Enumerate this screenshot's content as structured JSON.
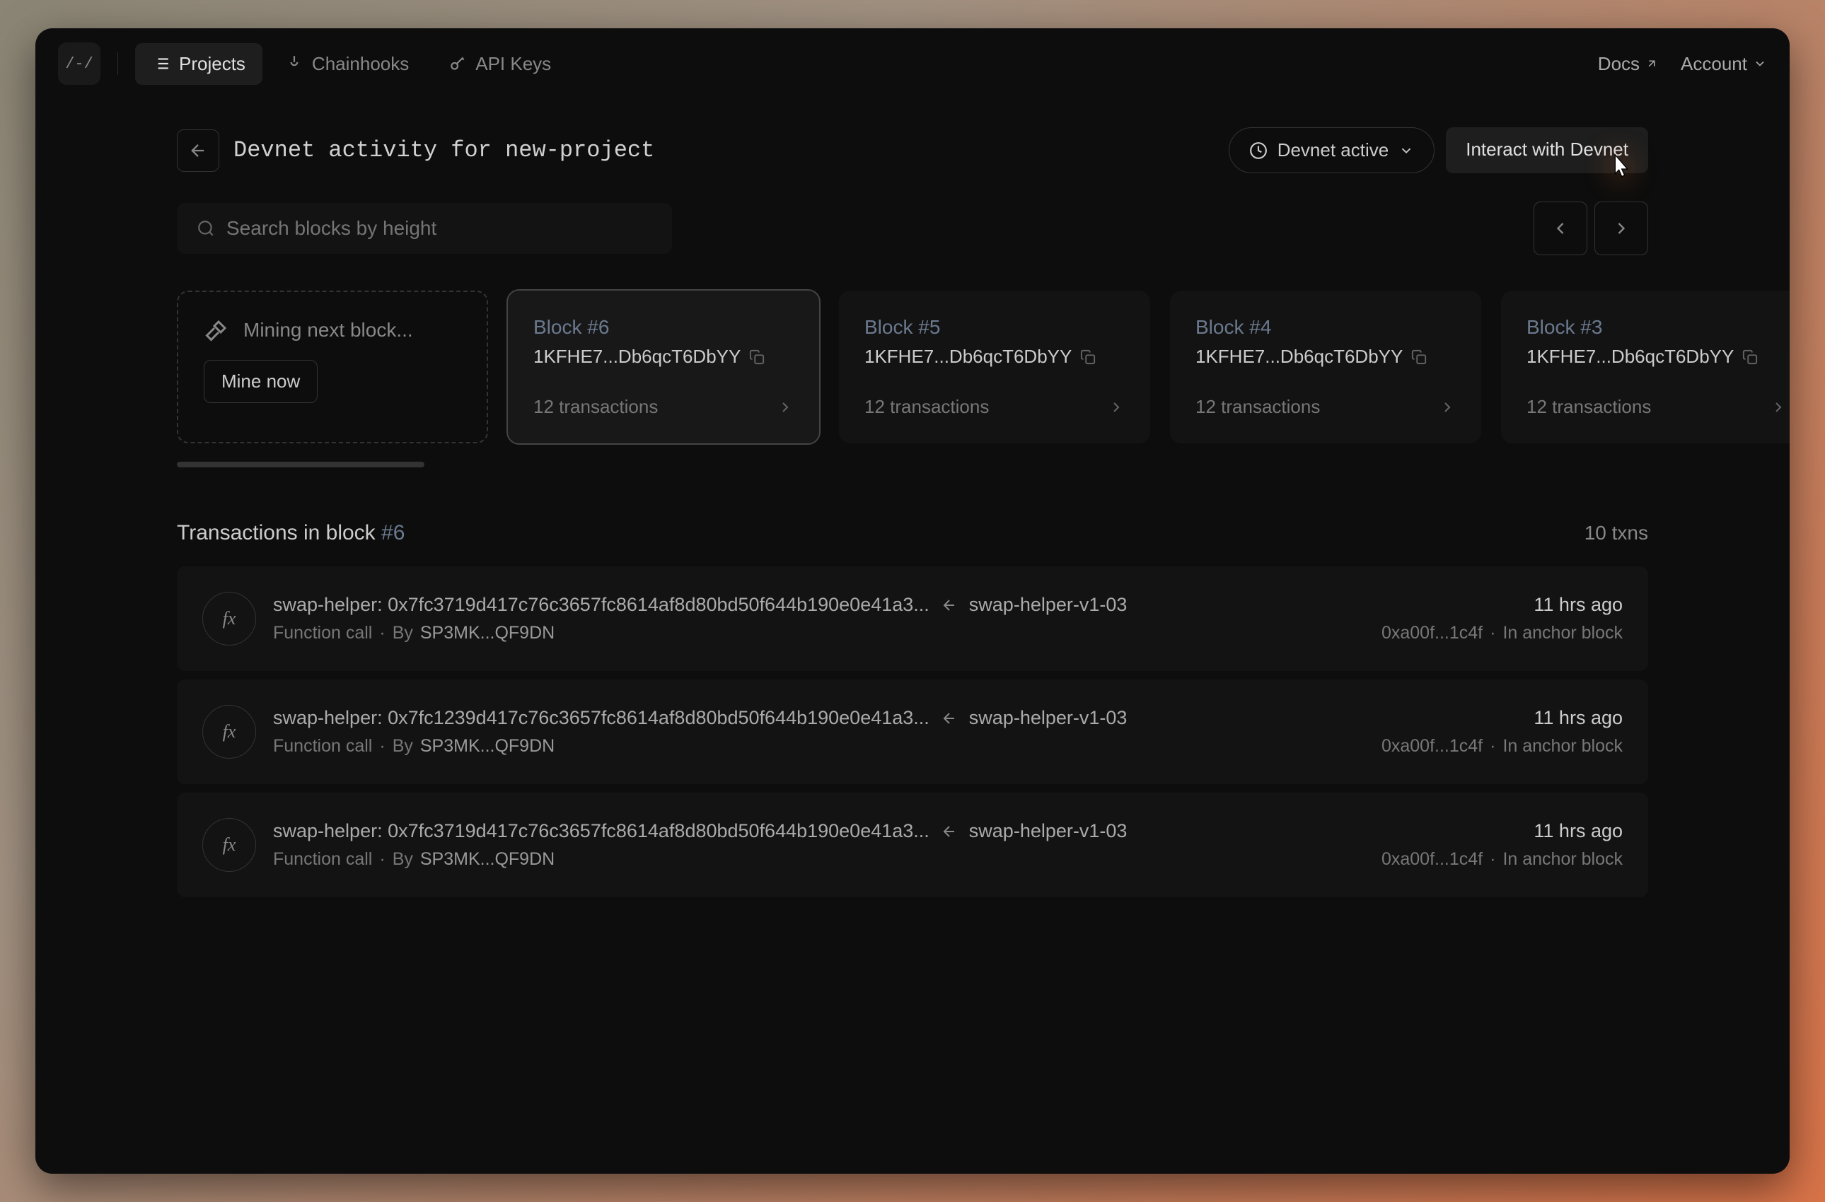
{
  "logo_text": "/-/",
  "nav": {
    "projects": "Projects",
    "chainhooks": "Chainhooks",
    "api_keys": "API Keys",
    "docs": "Docs",
    "account": "Account"
  },
  "page": {
    "title": "Devnet activity for new-project",
    "status_label": "Devnet active",
    "interact_label": "Interact with Devnet"
  },
  "search": {
    "placeholder": "Search blocks by height"
  },
  "mining": {
    "label": "Mining next block...",
    "button": "Mine now"
  },
  "blocks": [
    {
      "title": "Block #6",
      "hash": "1KFHE7...Db6qcT6DbYY",
      "txns": "12 transactions",
      "selected": true
    },
    {
      "title": "Block #5",
      "hash": "1KFHE7...Db6qcT6DbYY",
      "txns": "12 transactions",
      "selected": false
    },
    {
      "title": "Block #4",
      "hash": "1KFHE7...Db6qcT6DbYY",
      "txns": "12 transactions",
      "selected": false
    },
    {
      "title": "Block #3",
      "hash": "1KFHE7...Db6qcT6DbYY",
      "txns": "12 transactions",
      "selected": false
    }
  ],
  "txn_section": {
    "title_prefix": "Transactions in block ",
    "block_num": "#6",
    "count": "10 txns"
  },
  "transactions": [
    {
      "main": "swap-helper: 0x7fc3719d417c76c3657fc8614af8d80bd50f644b190e0e41a3...",
      "target": "swap-helper-v1-03",
      "type": "Function call",
      "by_label": "By",
      "by": "SP3MK...QF9DN",
      "time": "11 hrs ago",
      "hash": "0xa00f...1c4f",
      "location": "In anchor block"
    },
    {
      "main": "swap-helper: 0x7fc1239d417c76c3657fc8614af8d80bd50f644b190e0e41a3...",
      "target": "swap-helper-v1-03",
      "type": "Function call",
      "by_label": "By",
      "by": "SP3MK...QF9DN",
      "time": "11 hrs ago",
      "hash": "0xa00f...1c4f",
      "location": "In anchor block"
    },
    {
      "main": "swap-helper: 0x7fc3719d417c76c3657fc8614af8d80bd50f644b190e0e41a3...",
      "target": "swap-helper-v1-03",
      "type": "Function call",
      "by_label": "By",
      "by": "SP3MK...QF9DN",
      "time": "11 hrs ago",
      "hash": "0xa00f...1c4f",
      "location": "In anchor block"
    }
  ]
}
